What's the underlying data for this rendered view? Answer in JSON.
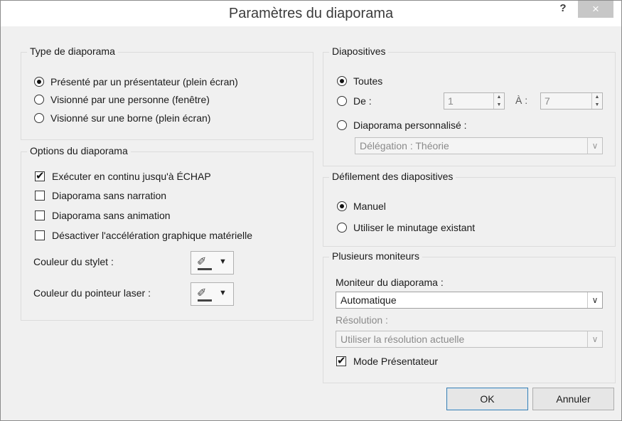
{
  "window": {
    "title": "Paramètres du diaporama",
    "help": "?",
    "close": "×"
  },
  "type_group": {
    "title": "Type de diaporama",
    "options": [
      {
        "label": "Présenté par un présentateur (plein écran)",
        "selected": true
      },
      {
        "label": "Visionné par une personne (fenêtre)",
        "selected": false
      },
      {
        "label": "Visionné sur une borne (plein écran)",
        "selected": false
      }
    ]
  },
  "options_group": {
    "title": "Options du diaporama",
    "checks": [
      {
        "label": "Exécuter en continu jusqu'à ÉCHAP",
        "checked": true
      },
      {
        "label": "Diaporama sans narration",
        "checked": false
      },
      {
        "label": "Diaporama sans animation",
        "checked": false
      },
      {
        "label": "Désactiver l'accélération graphique matérielle",
        "checked": false
      }
    ],
    "pen_color_label": "Couleur du stylet :",
    "laser_color_label": "Couleur du pointeur laser :"
  },
  "slides_group": {
    "title": "Diapositives",
    "all_label": "Toutes",
    "from_label": "De :",
    "from_value": "1",
    "to_label": "À :",
    "to_value": "7",
    "custom_label": "Diaporama personnalisé :",
    "custom_value": "Délégation : Théorie"
  },
  "advance_group": {
    "title": "Défilement des diapositives",
    "manual_label": "Manuel",
    "timing_label": "Utiliser le minutage existant"
  },
  "monitors_group": {
    "title": "Plusieurs moniteurs",
    "monitor_label": "Moniteur du diaporama :",
    "monitor_value": "Automatique",
    "resolution_label": "Résolution :",
    "resolution_value": "Utiliser la résolution actuelle",
    "presenter_label": "Mode Présentateur"
  },
  "buttons": {
    "ok": "OK",
    "cancel": "Annuler"
  }
}
